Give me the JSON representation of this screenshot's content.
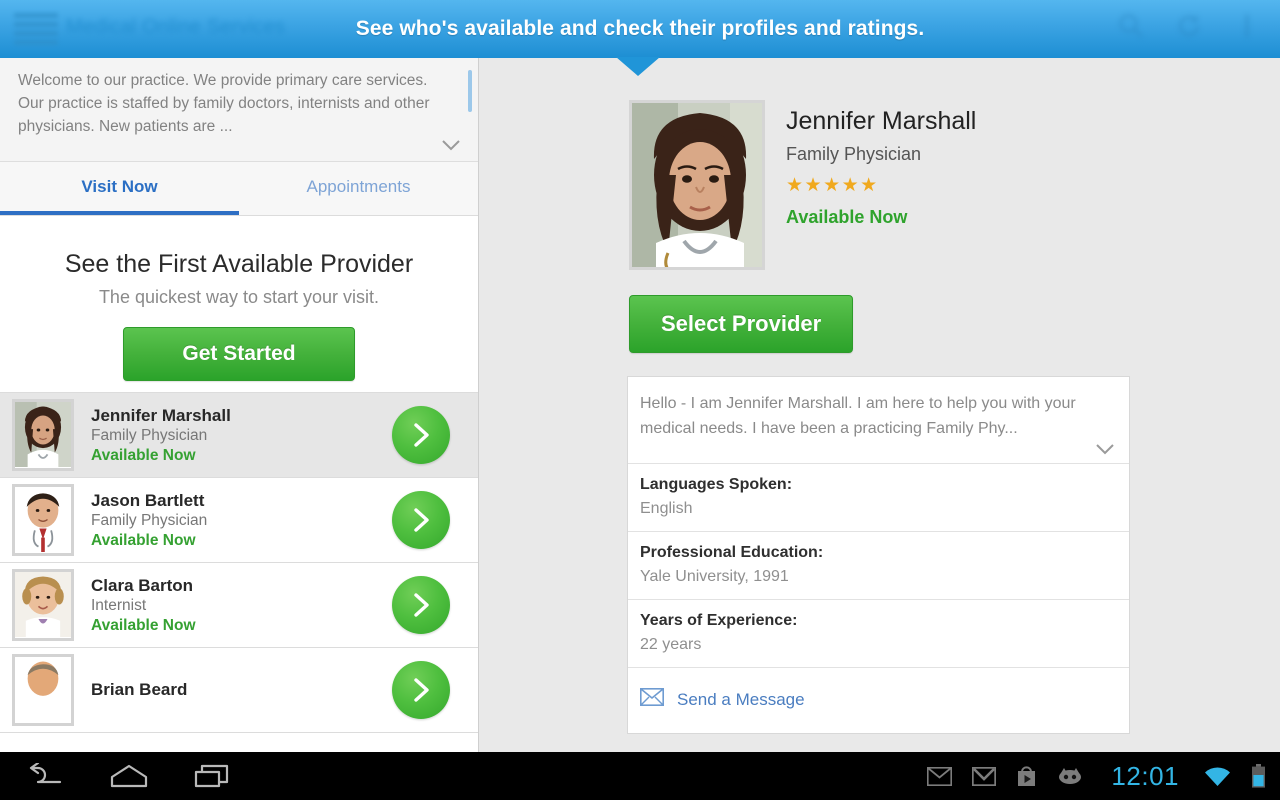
{
  "actionbar": {
    "app_title": "Medical Online Services",
    "menu_icon": "hamburger-menu-icon",
    "icons": [
      "search-icon",
      "refresh-icon",
      "overflow-menu-icon"
    ]
  },
  "tooltip": {
    "text": "See who's available and check their profiles and ratings."
  },
  "left_panel": {
    "welcome_text": "Welcome to our practice. We provide primary care services. Our practice is staffed by family doctors, internists and other physicians. New patients are ...",
    "expand_icon": "chevron-down-icon",
    "tabs": [
      {
        "label": "Visit Now",
        "active": true
      },
      {
        "label": "Appointments",
        "active": false
      }
    ],
    "first_available": {
      "title": "See the First Available Provider",
      "subtitle": "The quickest way to start your visit.",
      "button_label": "Get Started"
    },
    "providers": [
      {
        "name": "Jennifer Marshall",
        "specialty": "Family Physician",
        "availability": "Available Now",
        "selected": true
      },
      {
        "name": "Jason Bartlett",
        "specialty": "Family Physician",
        "availability": "Available Now",
        "selected": false
      },
      {
        "name": "Clara Barton",
        "specialty": "Internist",
        "availability": "Available Now",
        "selected": false
      },
      {
        "name": "Brian Beard",
        "specialty": "",
        "availability": "",
        "selected": false
      }
    ]
  },
  "detail": {
    "name": "Jennifer Marshall",
    "specialty": "Family Physician",
    "rating_stars": "★★★★★",
    "rating_value": 5,
    "availability": "Available Now",
    "select_button_label": "Select Provider",
    "bio": "Hello - I am Jennifer Marshall. I am here to help you with your medical needs. I have been a practicing Family Phy...",
    "bio_expand_icon": "chevron-down-icon",
    "rows": [
      {
        "label": "Languages Spoken:",
        "value": "English"
      },
      {
        "label": "Professional Education:",
        "value": "Yale University, 1991"
      },
      {
        "label": "Years of Experience:",
        "value": "22 years"
      }
    ],
    "message_link": "Send a Message",
    "message_icon": "envelope-icon"
  },
  "system_bar": {
    "nav": [
      "back-icon",
      "home-icon",
      "recents-icon"
    ],
    "status_icons": [
      "email-icon",
      "gmail-icon",
      "play-store-icon",
      "cyanogenmod-icon",
      "wifi-icon",
      "battery-icon"
    ],
    "clock": "12:01"
  },
  "colors": {
    "accent_blue": "#2095d8",
    "green_button": "#45b23c",
    "available_green": "#35a132",
    "star_gold": "#f0a91e",
    "tab_active_blue": "#2e6fc4",
    "link_blue": "#4a7dc0",
    "clock_cyan": "#33b5e5"
  }
}
